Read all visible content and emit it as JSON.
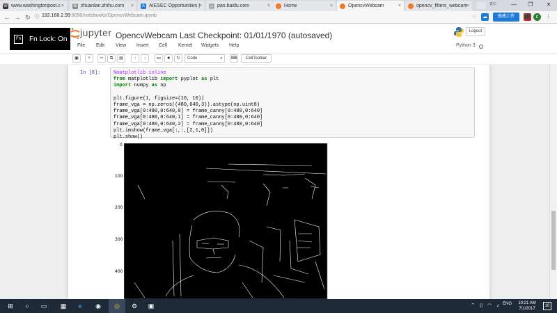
{
  "browser": {
    "tabs": [
      {
        "label": "www.washingtonpost.c",
        "favicon": "wp"
      },
      {
        "label": "zhuanlan.zhihu.com",
        "favicon": "zh"
      },
      {
        "label": "AIESEC Opportunities |",
        "favicon": "A"
      },
      {
        "label": "pan.baidu.com",
        "favicon": "pb"
      },
      {
        "label": "Home",
        "favicon": "jupyter"
      },
      {
        "label": "OpencvWebcam",
        "favicon": "jupyter"
      },
      {
        "label": "opencv_filters_webcam",
        "favicon": "jupyter"
      }
    ],
    "active_tab": 5,
    "url_host": "192.168.2.99",
    "url_rest": ":9090/notebooks/OpencvWebcam.ipynb",
    "user_label": "史仁",
    "upload_label": "拖拽上传"
  },
  "jupyter": {
    "fnlock_key": "Fn",
    "fnlock_text": "Fn Lock: On",
    "logo_text": "jupyter",
    "notebook_title": "OpencvWebcam Last Checkpoint: 01/01/1970 (autosaved)",
    "logout_label": "Logout",
    "menu": [
      "File",
      "Edit",
      "View",
      "Insert",
      "Cell",
      "Kernel",
      "Widgets",
      "Help"
    ],
    "kernel_name": "Python 3",
    "celltype": "Code",
    "celltoolbar_label": "CellToolbar"
  },
  "cell": {
    "prompt": "In [8]:",
    "code_lines": [
      "%matplotlib inline",
      "from matplotlib import pyplot as plt",
      "import numpy as np",
      "",
      "plt.figure(1, figsize=(10, 10))",
      "frame_vga = np.zeros((480,640,3)).astype(np.uint8)",
      "frame_vga[0:480,0:640,0] = frame_canny[0:480,0:640]",
      "frame_vga[0:480,0:640,1] = frame_canny[0:480,0:640]",
      "frame_vga[0:480,0:640,2] = frame_canny[0:480,0:640]",
      "plt.imshow(frame_vga[:,:,[2,1,0]])",
      "plt.show()"
    ]
  },
  "plot": {
    "y_ticks": [
      "0",
      "100",
      "200",
      "300",
      "400"
    ]
  },
  "taskbar": {
    "lang": "ENG",
    "time": "10:21 AM",
    "date": "7/1/2017",
    "notif_count": "10"
  }
}
